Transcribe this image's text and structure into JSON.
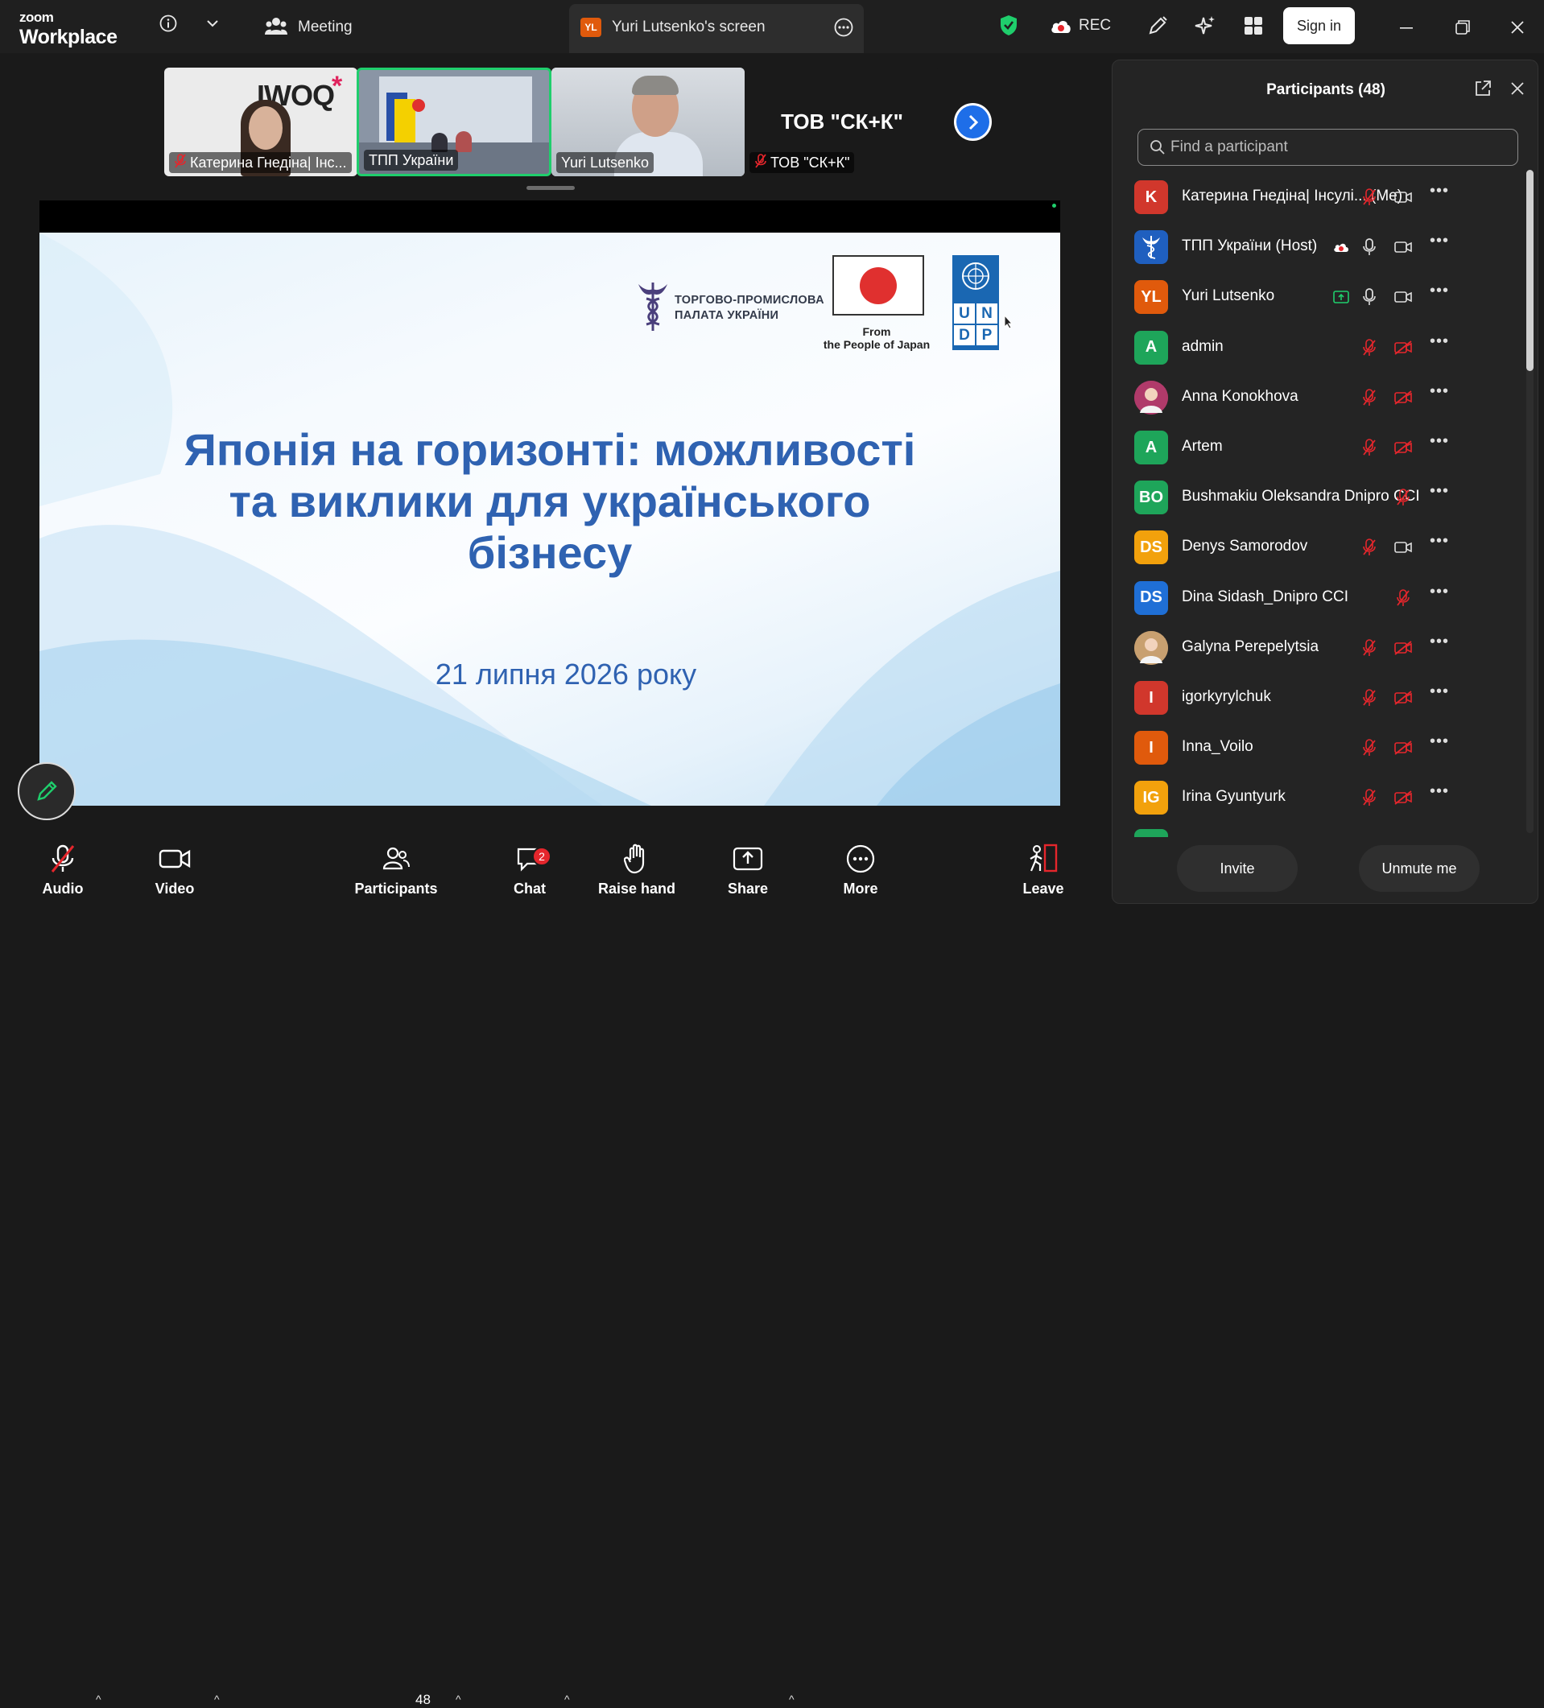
{
  "app": {
    "logo_top": "zoom",
    "logo_bottom": "Workplace"
  },
  "topbar": {
    "meeting_tab": "Meeting",
    "screen_tab_badge": "YL",
    "screen_tab": "Yuri Lutsenko's screen",
    "rec_label": "REC",
    "signin_label": "Sign in"
  },
  "thumbnails": [
    {
      "label": "Катерина Гнедіна| Інс...",
      "muted": true,
      "logo_text": "IWOQ"
    },
    {
      "label": "ТПП України",
      "muted": false,
      "active": true
    },
    {
      "label": "Yuri Lutsenko",
      "muted": false
    },
    {
      "label": "ТОВ \"СК+К\"",
      "muted": true,
      "name_tile": "ТОВ \"СК+К\""
    }
  ],
  "slide": {
    "org_line1": "ТОРГОВО-ПРОМИСЛОВА",
    "org_line2": "ПАЛАТА УКРАЇНИ",
    "japan_line1": "From",
    "japan_line2": "the People of Japan",
    "undp_letters": [
      "U",
      "N",
      "D",
      "P"
    ],
    "title_line1": "Японія на горизонті: можливості",
    "title_line2": "та виклики для українського",
    "title_line3": "бізнесу",
    "date": "21 липня 2026 року"
  },
  "toolbar": {
    "audio": "Audio",
    "video": "Video",
    "participants": "Participants",
    "participants_count": "48",
    "chat": "Chat",
    "chat_badge": "2",
    "raise_hand": "Raise hand",
    "share": "Share",
    "more": "More",
    "leave": "Leave"
  },
  "panel": {
    "title": "Participants (48)",
    "search_placeholder": "Find a participant",
    "invite": "Invite",
    "unmute": "Unmute me",
    "participants": [
      {
        "initials": "K",
        "color": "#d1372c",
        "name": "Катерина Гнедіна| Інсулі...  (Me)",
        "mic": "muted",
        "cam": "on"
      },
      {
        "initials": "",
        "color": "#1f5fbf",
        "name": "ТПП України (Host)",
        "mic": "on",
        "cam": "on",
        "cloud": true
      },
      {
        "initials": "YL",
        "color": "#e05a0c",
        "name": "Yuri Lutsenko",
        "mic": "on",
        "cam": "on",
        "sharing": true
      },
      {
        "initials": "A",
        "color": "#1ea55a",
        "name": "admin",
        "mic": "muted",
        "cam": "off"
      },
      {
        "initials": "",
        "color": "#b03a6a",
        "name": "Anna Konokhova",
        "mic": "muted",
        "cam": "off",
        "photo": true
      },
      {
        "initials": "A",
        "color": "#1ea55a",
        "name": "Artem",
        "mic": "muted",
        "cam": "off"
      },
      {
        "initials": "BO",
        "color": "#1ea55a",
        "name": "Bushmakiu Oleksandra Dnipro CCI",
        "mic": "muted",
        "cam": "none"
      },
      {
        "initials": "DS",
        "color": "#f2a10c",
        "name": "Denys Samorodov",
        "mic": "muted",
        "cam": "on"
      },
      {
        "initials": "DS",
        "color": "#1f6fd6",
        "name": "Dina Sidash_Dnipro CCI",
        "mic": "muted",
        "cam": "none"
      },
      {
        "initials": "",
        "color": "#c8a070",
        "name": "Galyna Perepelytsia",
        "mic": "muted",
        "cam": "off",
        "photo": true
      },
      {
        "initials": "I",
        "color": "#d1372c",
        "name": "igorkyrylchuk",
        "mic": "muted",
        "cam": "off"
      },
      {
        "initials": "I",
        "color": "#e05a0c",
        "name": "Inna_Voilo",
        "mic": "muted",
        "cam": "off"
      },
      {
        "initials": "IG",
        "color": "#f2a10c",
        "name": "Irina Gyuntyurk",
        "mic": "muted",
        "cam": "off"
      }
    ]
  },
  "colors": {
    "accent": "#1e6ee8",
    "slide_text": "#2f62b1",
    "muted_red": "#e5262c",
    "active_green": "#1fce6c"
  }
}
